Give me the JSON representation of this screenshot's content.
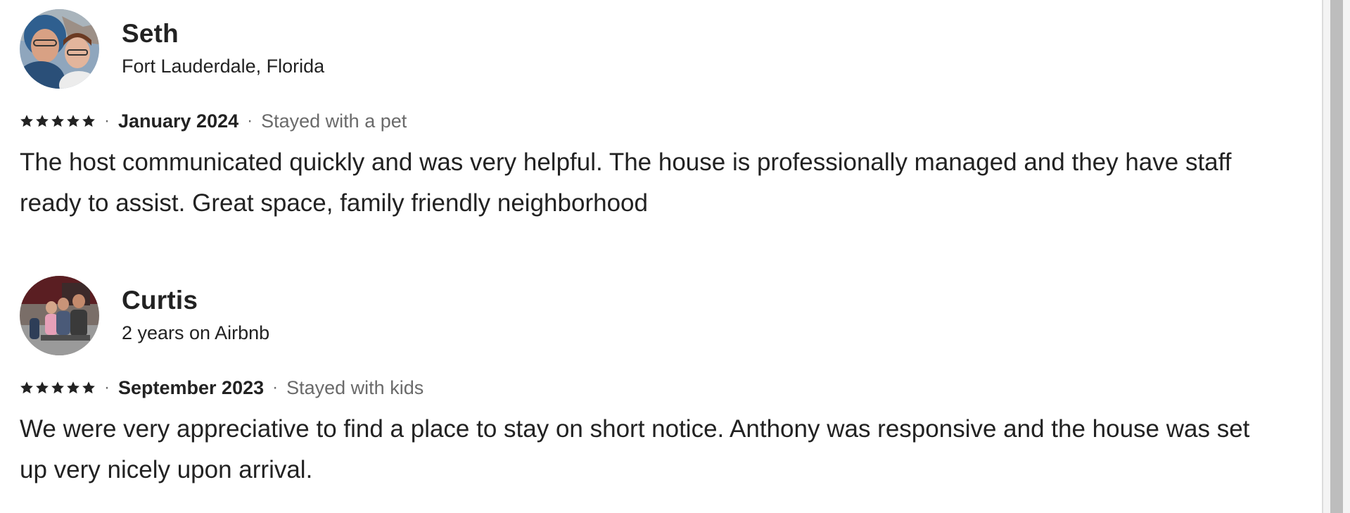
{
  "reviews": [
    {
      "name": "Seth",
      "subtitle": "Fort Lauderdale, Florida",
      "rating": 5,
      "date": "January 2024",
      "stay_type": "Stayed with a pet",
      "text": "The host communicated quickly and was very helpful. The house is professionally managed and they have staff ready to assist. Great space, family friendly neighborhood"
    },
    {
      "name": "Curtis",
      "subtitle": "2 years on Airbnb",
      "rating": 5,
      "date": "September 2023",
      "stay_type": "Stayed with kids",
      "text": "We were very appreciative to find a place to stay on short notice. Anthony was responsive and the house was set up very nicely upon arrival."
    }
  ],
  "separator": "·",
  "icons": {
    "star": "star-icon"
  },
  "colors": {
    "text_primary": "#222222",
    "text_secondary": "#6a6a6a",
    "star": "#222222"
  }
}
